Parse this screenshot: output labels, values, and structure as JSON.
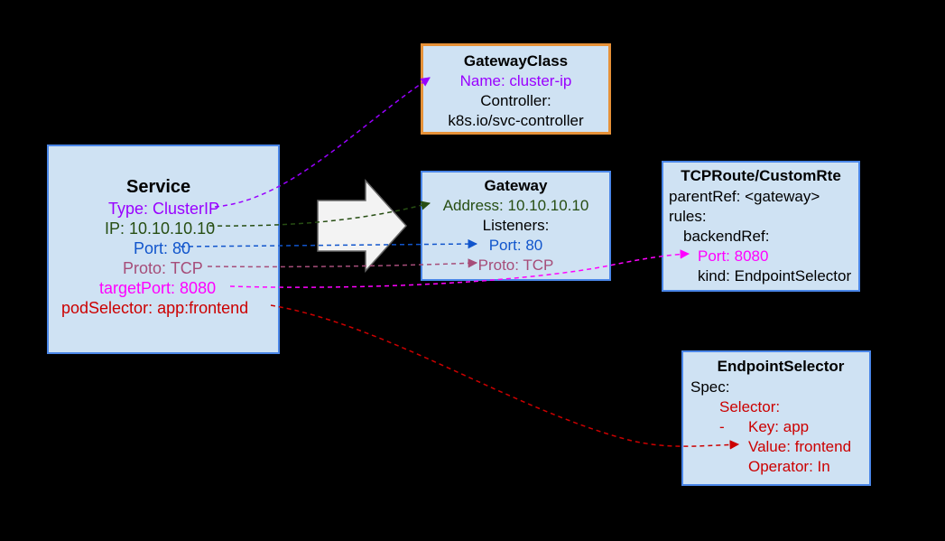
{
  "service": {
    "title": "Service",
    "type": "Type: ClusterIP",
    "ip": "IP: 10.10.10.10",
    "port": "Port: 80",
    "proto": "Proto: TCP",
    "targetPort": "targetPort: 8080",
    "podSelector": "podSelector: app:frontend"
  },
  "gatewayClass": {
    "title": "GatewayClass",
    "name": "Name: cluster-ip",
    "controllerLabel": "Controller:",
    "controllerValue": "k8s.io/svc-controller"
  },
  "gateway": {
    "title": "Gateway",
    "address": "Address: 10.10.10.10",
    "listeners": "Listeners:",
    "port": "Port: 80",
    "proto": "Proto: TCP"
  },
  "route": {
    "title": "TCPRoute/CustomRte",
    "parentRef": "parentRef: <gateway>",
    "rules": "rules:",
    "backendRef": "backendRef:",
    "port": "Port: 8080",
    "kind": "kind:  EndpointSelector"
  },
  "endpointSelector": {
    "title": "EndpointSelector",
    "spec": "Spec:",
    "selector": "Selector:",
    "dash": "-",
    "key": "Key: app",
    "value": "Value: frontend",
    "operator": "Operator: In"
  }
}
